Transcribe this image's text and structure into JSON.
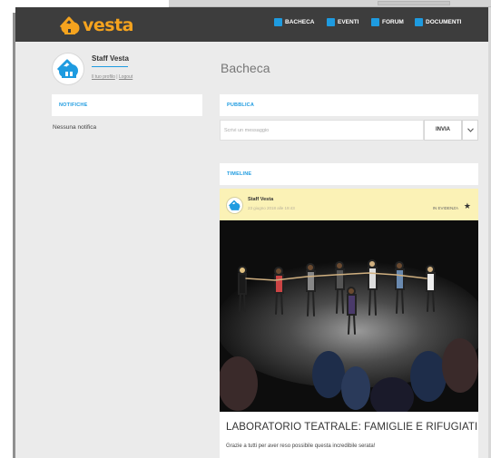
{
  "app": {
    "logo_text": "vesta",
    "colors": {
      "navbar": "#3d3d3d",
      "accent": "#1e9be0",
      "brand": "#f5a31e",
      "highlight": "#fbf2b6",
      "background": "#ebebeb"
    }
  },
  "nav": {
    "items": [
      {
        "label": "BACHECA",
        "icon": "board-icon"
      },
      {
        "label": "EVENTI",
        "icon": "calendar-icon"
      },
      {
        "label": "FORUM",
        "icon": "chat-icon"
      },
      {
        "label": "DOCUMENTI",
        "icon": "folder-icon"
      }
    ]
  },
  "profile": {
    "name": "Staff Vesta",
    "links": "Il tuo profilo | Logout",
    "link_profile": "Il tuo profilo",
    "link_sep": " | ",
    "link_logout": "Logout"
  },
  "page": {
    "title": "Bacheca"
  },
  "notifiche": {
    "title": "NOTIFICHE",
    "empty_text": "Nessuna notifica"
  },
  "pubblica": {
    "title": "PUBBLICA",
    "placeholder": "Scrivi un messaggio",
    "send_label": "INVIA",
    "dropdown_icon": "chevron-down-icon"
  },
  "timeline": {
    "title": "TIMELINE",
    "post": {
      "author": "Staff Vesta",
      "date": "23 giugno 2018 alle 19:43",
      "badge": "IN EVIDENZA",
      "badge_icon": "star-icon",
      "title": "LABORATORIO TEATRALE: FAMIGLIE E RIFUGIATI",
      "text": "Grazie a tutti per aver reso possibile questa incredibile serata!"
    }
  }
}
